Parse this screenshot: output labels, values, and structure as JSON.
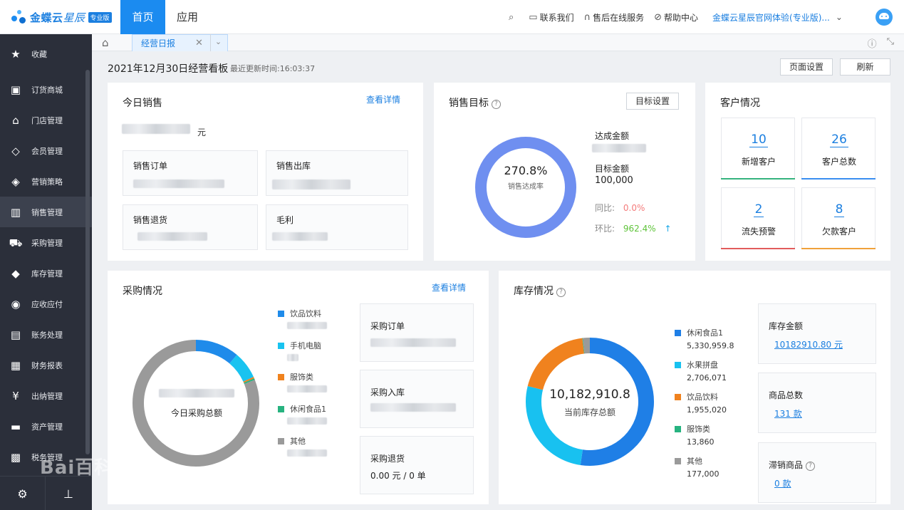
{
  "topbar": {
    "brand": "金蝶云",
    "brand_star": "星辰",
    "edition_badge": "专业版",
    "nav": [
      {
        "label": "首页"
      },
      {
        "label": "应用"
      }
    ],
    "actions": [
      {
        "label": "联系我们"
      },
      {
        "label": "售后在线服务"
      },
      {
        "label": "帮助中心"
      }
    ],
    "account": "金蝶云星辰官网体验(专业版)..."
  },
  "sidebar": {
    "items": [
      {
        "label": "收藏"
      },
      {
        "label": "订货商城"
      },
      {
        "label": "门店管理"
      },
      {
        "label": "会员管理"
      },
      {
        "label": "营销策略"
      },
      {
        "label": "销售管理"
      },
      {
        "label": "采购管理"
      },
      {
        "label": "库存管理"
      },
      {
        "label": "应收应付"
      },
      {
        "label": "账务处理"
      },
      {
        "label": "财务报表"
      },
      {
        "label": "出纳管理"
      },
      {
        "label": "资产管理"
      },
      {
        "label": "税务管理"
      }
    ],
    "active_index": 5
  },
  "tabs": {
    "current": "经营日报"
  },
  "header": {
    "title": "2021年12月30日经营看板",
    "updated": "最近更新时间:16:03:37",
    "btn_page_settings": "页面设置",
    "btn_refresh": "刷新"
  },
  "today_sales": {
    "title": "今日销售",
    "detail_link": "查看详情",
    "currency_unit": "元",
    "boxes": [
      {
        "label": "销售订单"
      },
      {
        "label": "销售出库"
      },
      {
        "label": "销售退货"
      },
      {
        "label": "毛利"
      }
    ]
  },
  "sales_target": {
    "title": "销售目标",
    "settings_btn": "目标设置",
    "rate": "270.8%",
    "rate_label": "销售达成率",
    "achieved_label": "达成金额",
    "target_label": "目标金额",
    "target_value": "100,000",
    "yoy_label": "同比:",
    "yoy_value": "0.0%",
    "mom_label": "环比:",
    "mom_value": "962.4%",
    "colors": {
      "ring": "#6f8ff0",
      "yoy": "#f47b7b",
      "mom": "#5fc43a"
    }
  },
  "customers": {
    "title": "客户情况",
    "boxes": [
      {
        "value": "10",
        "label": "新增客户",
        "color": "#36b37e"
      },
      {
        "value": "26",
        "label": "客户总数",
        "color": "#3a8ef0"
      },
      {
        "value": "2",
        "label": "流失预警",
        "color": "#e25c5c"
      },
      {
        "value": "8",
        "label": "欠款客户",
        "color": "#f0a23a"
      }
    ]
  },
  "purchase": {
    "title": "采购情况",
    "detail_link": "查看详情",
    "center_label": "今日采购总额",
    "legend": [
      {
        "name": "饮品饮料",
        "color": "#1f8bea"
      },
      {
        "name": "手机电脑",
        "color": "#19c3f0"
      },
      {
        "name": "服饰类",
        "color": "#f0821e"
      },
      {
        "name": "休闲食品1",
        "color": "#27b380"
      },
      {
        "name": "其他",
        "color": "#9a9a9a"
      }
    ],
    "boxes": [
      {
        "label": "采购订单"
      },
      {
        "label": "采购入库"
      },
      {
        "label": "采购退货",
        "value": "0.00 元 / 0 单"
      }
    ]
  },
  "inventory": {
    "title": "库存情况",
    "center_value": "10,182,910.8",
    "center_label": "当前库存总额",
    "legend": [
      {
        "name": "休闲食品1",
        "value": "5,330,959.8",
        "color": "#1f7fe6"
      },
      {
        "name": "水果拼盘",
        "value": "2,706,071",
        "color": "#18c1f0"
      },
      {
        "name": "饮品饮料",
        "value": "1,955,020",
        "color": "#f0821e"
      },
      {
        "name": "服饰类",
        "value": "13,860",
        "color": "#27b380"
      },
      {
        "name": "其他",
        "value": "177,000",
        "color": "#9a9a9a"
      }
    ],
    "stats": [
      {
        "label": "库存金额",
        "value": "10182910.80 元"
      },
      {
        "label": "商品总数",
        "value": "131 款"
      },
      {
        "label": "滞销商品",
        "value": "0 款"
      }
    ]
  },
  "chart_data": [
    {
      "type": "pie",
      "title": "",
      "categories": [
        "达成",
        "目标"
      ],
      "values": [
        270.8,
        100
      ],
      "colors": [
        "#6f8ff0"
      ]
    },
    {
      "type": "pie",
      "title": "",
      "categories": [
        "饮品饮料",
        "手机电脑",
        "服饰类",
        "休闲食品1",
        "其他"
      ],
      "values": [
        11.2,
        7.0,
        0.4,
        0.4,
        81.0
      ]
    },
    {
      "type": "pie",
      "title": "",
      "categories": [
        "休闲食品1",
        "水果拼盘",
        "饮品饮料",
        "服饰类",
        "其他"
      ],
      "values": [
        5330959.8,
        2706071,
        1955020,
        13860,
        177000
      ]
    }
  ],
  "watermark": "Bai百科"
}
